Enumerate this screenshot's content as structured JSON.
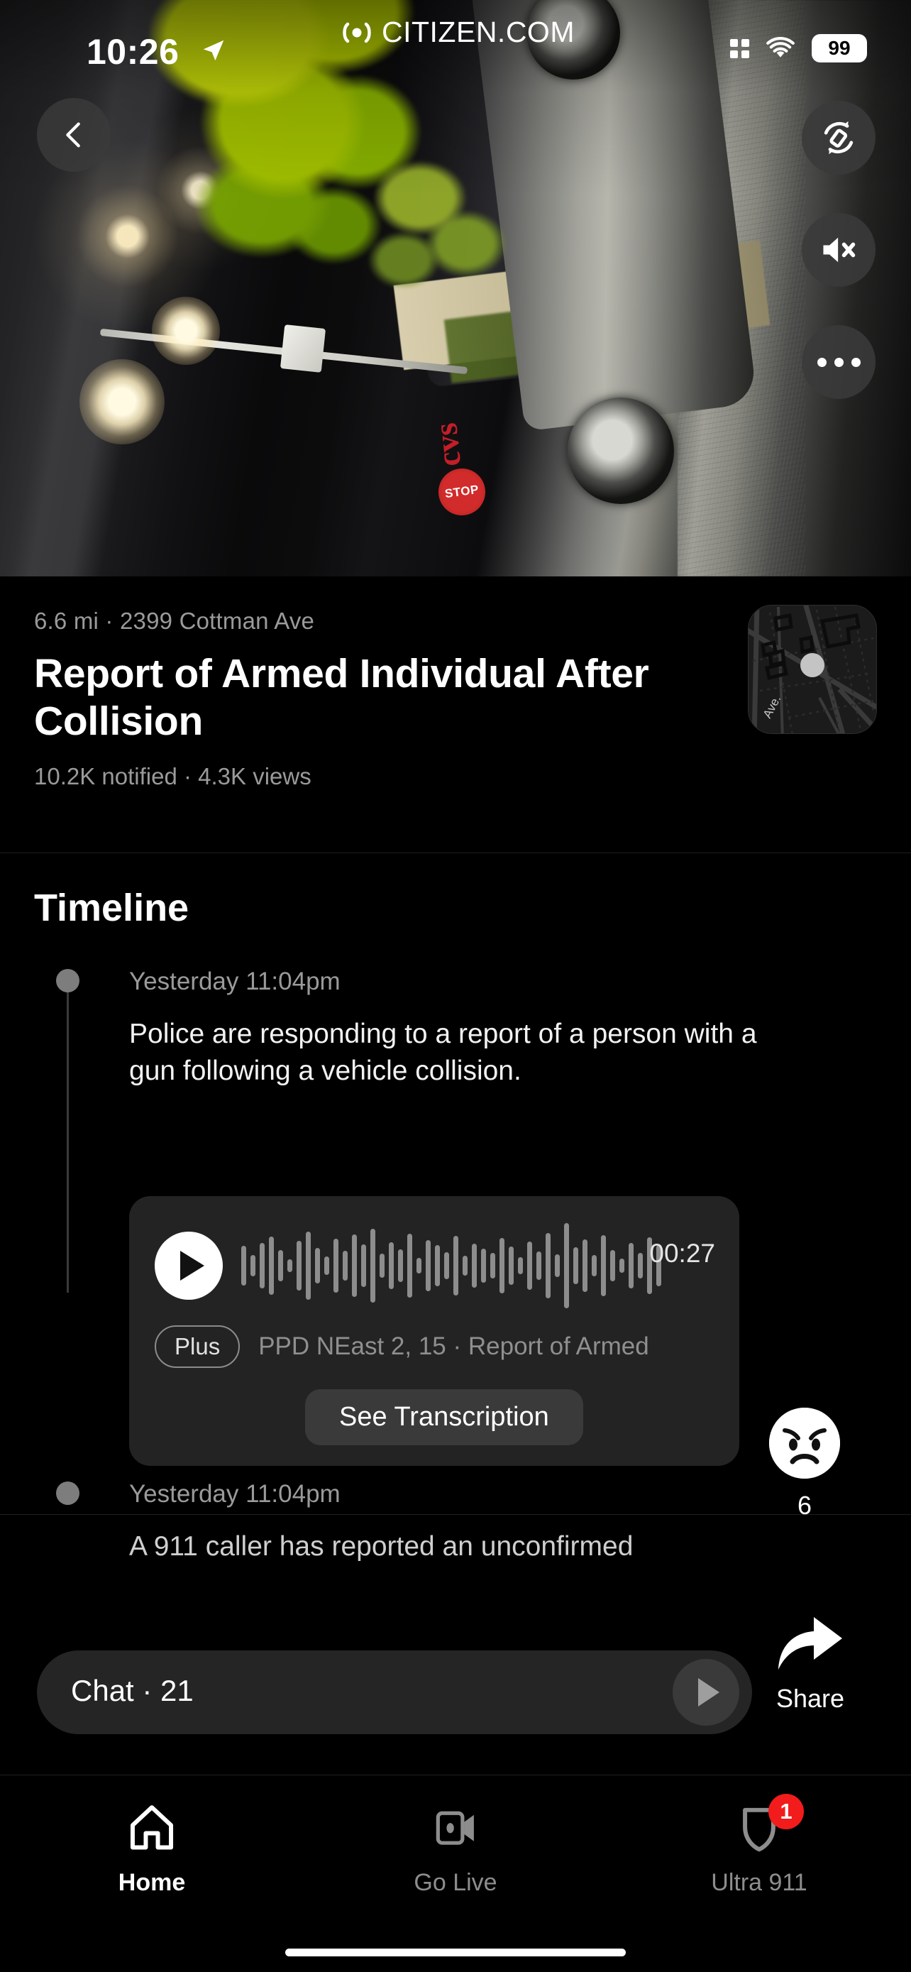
{
  "status_bar": {
    "time": "10:26",
    "location_icon": "location-arrow-icon",
    "grid_icon": "app-grid-icon",
    "wifi_icon": "wifi-icon",
    "battery_level": "99"
  },
  "watermark": {
    "logo_icon": "citizen-broadcast-icon",
    "text": "CITIZEN.COM"
  },
  "hero": {
    "back_icon": "chevron-left-icon",
    "controls": [
      {
        "name": "rotate-screen-button",
        "icon": "rotate-device-icon"
      },
      {
        "name": "mute-button",
        "icon": "speaker-mute-icon"
      },
      {
        "name": "more-options-button",
        "icon": "ellipsis-icon"
      }
    ]
  },
  "event": {
    "meta": "6.6 mi · 2399 Cottman Ave",
    "title": "Report of Armed Individual After Collision",
    "stats": "10.2K notified · 4.3K views",
    "map_label": "Ave."
  },
  "timeline": {
    "heading": "Timeline",
    "entries": [
      {
        "time": "Yesterday 11:04pm",
        "body": "Police are responding to a report of a person with a gun following a vehicle collision."
      },
      {
        "time": "Yesterday 11:04pm",
        "body": "A 911 caller has reported an unconfirmed"
      }
    ],
    "audio": {
      "play_icon": "play-icon",
      "duration": "00:27",
      "badge": "Plus",
      "source": "PPD NEast 2, 15 · Report of Armed",
      "transcription_label": "See Transcription"
    },
    "reaction": {
      "icon": "angry-face-icon",
      "count": "6"
    }
  },
  "chat": {
    "label": "Chat · 21",
    "send_icon": "send-arrow-icon"
  },
  "share": {
    "icon": "share-arrow-icon",
    "label": "Share"
  },
  "tab_bar": {
    "items": [
      {
        "label": "Home",
        "icon": "home-icon",
        "active": true,
        "badge": ""
      },
      {
        "label": "Go Live",
        "icon": "video-camera-icon",
        "active": false,
        "badge": ""
      },
      {
        "label": "Ultra 911",
        "icon": "shield-icon",
        "active": false,
        "badge": "1"
      }
    ]
  },
  "colors": {
    "background": "#000000",
    "accent_red": "#f21c1c",
    "muted_text": "#9a9a9a",
    "card": "#232323"
  }
}
